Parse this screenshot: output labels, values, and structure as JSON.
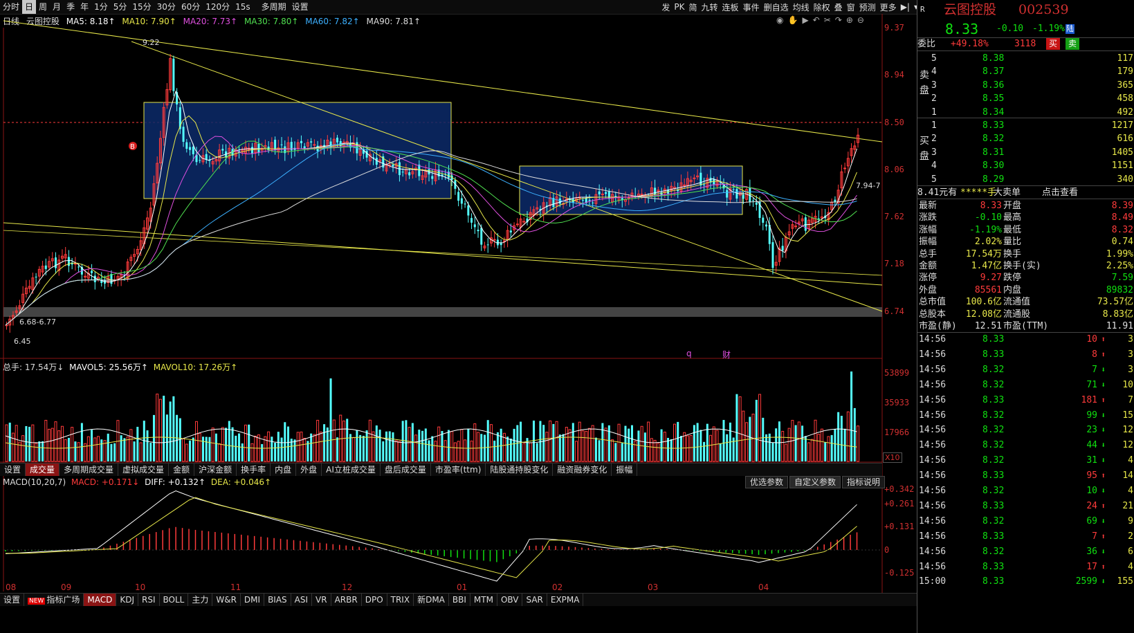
{
  "toolbar": {
    "periods": [
      "分时",
      "日",
      "周",
      "月",
      "季",
      "年",
      "1分",
      "5分",
      "15分",
      "30分",
      "60分",
      "120分",
      "15s",
      "多周期",
      "设置"
    ],
    "active_period": "日",
    "right_items": [
      "发",
      "PK",
      "简",
      "九转",
      "连板",
      "事件",
      "删自选",
      "均线",
      "除权",
      "叠",
      "窗",
      "预测",
      "更多"
    ]
  },
  "ma_line": {
    "period": "日线",
    "stock": "云图控股",
    "ma5": "MA5: 8.18↑",
    "ma10": "MA10: 7.90↑",
    "ma20": "MA20: 7.73↑",
    "ma30": "MA30: 7.80↑",
    "ma60": "MA60: 7.82↑",
    "ma90": "MA90: 7.81↑"
  },
  "price_axis": [
    "9.37",
    "8.94",
    "8.50",
    "8.06",
    "7.62",
    "7.18",
    "6.74"
  ],
  "price_annotations": {
    "high": "9.22",
    "low": "6.45",
    "range_low": "6.68-6.77",
    "range_right": "7.94-7",
    "buy_marker": "B"
  },
  "event_markers": [
    "q",
    "财"
  ],
  "volume": {
    "title": "总手: 17.54万↓",
    "mavol5": "MAVOL5: 25.56万↑",
    "mavol10": "MAVOL10: 17.26万↑",
    "axis": [
      "53899",
      "35933",
      "17966"
    ],
    "unit": "X10"
  },
  "sub_tabs": [
    "设置",
    "成交量",
    "多周期成交量",
    "虚拟成交量",
    "金额",
    "沪深金额",
    "换手率",
    "内盘",
    "外盘",
    "AI立桩成交量",
    "盘后成交量",
    "市盈率(ttm)",
    "陆股通持股变化",
    "融资融券变化",
    "振幅"
  ],
  "active_sub_tab": "成交量",
  "macd": {
    "title": "MACD(10,20,7)",
    "macd": "MACD: +0.171↓",
    "diff": "DIFF: +0.132↑",
    "dea": "DEA: +0.046↑",
    "axis": [
      "+0.342",
      "+0.261",
      "+0.131",
      "0",
      "-0.125"
    ],
    "buttons": [
      "优选参数",
      "自定义参数",
      "指标说明"
    ]
  },
  "x_axis": [
    "08",
    "09",
    "10",
    "11",
    "12",
    "01",
    "02",
    "03",
    "04"
  ],
  "bottom_bar": [
    "设置",
    "指标广场",
    "MACD",
    "KDJ",
    "RSI",
    "BOLL",
    "主力",
    "W&R",
    "DMI",
    "BIAS",
    "ASI",
    "VR",
    "ARBR",
    "DPO",
    "TRIX",
    "新DMA",
    "BBI",
    "MTM",
    "OBV",
    "SAR",
    "EXPMA"
  ],
  "bottom_new_tag": "NEW",
  "active_indicator": "MACD",
  "quote": {
    "tag": "R",
    "name": "云图控股",
    "code": "002539",
    "price": "8.33",
    "change": "-0.10",
    "change_pct": "-1.19%",
    "market": "陆",
    "weibi_label": "委比",
    "weibi": "+49.18%",
    "weicha": "3118",
    "buy_btn": "买",
    "sell_btn": "卖",
    "sell_label": "卖盘",
    "buy_label": "买盘",
    "sells": [
      {
        "lvl": "5",
        "price": "8.38",
        "vol": "117"
      },
      {
        "lvl": "4",
        "price": "8.37",
        "vol": "179"
      },
      {
        "lvl": "3",
        "price": "8.36",
        "vol": "365"
      },
      {
        "lvl": "2",
        "price": "8.35",
        "vol": "458"
      },
      {
        "lvl": "1",
        "price": "8.34",
        "vol": "492"
      }
    ],
    "buys": [
      {
        "lvl": "1",
        "price": "8.33",
        "vol": "1217"
      },
      {
        "lvl": "2",
        "price": "8.32",
        "vol": "616"
      },
      {
        "lvl": "3",
        "price": "8.31",
        "vol": "1405"
      },
      {
        "lvl": "4",
        "price": "8.30",
        "vol": "1151"
      },
      {
        "lvl": "5",
        "price": "8.29",
        "vol": "340"
      }
    ],
    "big_order": {
      "price": "8.41元有",
      "hands": "*****手",
      "label": "大卖单",
      "link": "点击查看"
    },
    "stats": [
      {
        "k1": "最新",
        "v1": "8.33",
        "k2": "开盘",
        "v2": "8.39",
        "c1": "red",
        "c2": "red"
      },
      {
        "k1": "涨跌",
        "v1": "-0.10",
        "k2": "最高",
        "v2": "8.49",
        "c1": "green",
        "c2": "red"
      },
      {
        "k1": "涨幅",
        "v1": "-1.19%",
        "k2": "最低",
        "v2": "8.32",
        "c1": "green",
        "c2": "red"
      },
      {
        "k1": "振幅",
        "v1": "2.02%",
        "k2": "量比",
        "v2": "0.74",
        "c1": "yellow",
        "c2": "yellow"
      },
      {
        "k1": "总手",
        "v1": "17.54万",
        "k2": "换手",
        "v2": "1.99%",
        "c1": "yellow",
        "c2": "yellow"
      },
      {
        "k1": "金额",
        "v1": "1.47亿",
        "k2": "换手(实)",
        "v2": "2.25%",
        "c1": "yellow",
        "c2": "yellow"
      },
      {
        "k1": "涨停",
        "v1": "9.27",
        "k2": "跌停",
        "v2": "7.59",
        "c1": "red",
        "c2": "green"
      },
      {
        "k1": "外盘",
        "v1": "85561",
        "k2": "内盘",
        "v2": "89832",
        "c1": "red",
        "c2": "green"
      },
      {
        "k1": "总市值",
        "v1": "100.6亿",
        "k2": "流通值",
        "v2": "73.57亿",
        "c1": "yellow",
        "c2": "yellow"
      },
      {
        "k1": "总股本",
        "v1": "12.08亿",
        "k2": "流通股",
        "v2": "8.83亿",
        "c1": "yellow",
        "c2": "yellow"
      },
      {
        "k1": "市盈(静)",
        "v1": "12.51",
        "k2": "市盈(TTM)",
        "v2": "11.91",
        "c1": "white",
        "c2": "white"
      }
    ],
    "ticks": [
      {
        "time": "14:56",
        "price": "8.33",
        "vol": "10",
        "dir": "up",
        "n": "3"
      },
      {
        "time": "14:56",
        "price": "8.33",
        "vol": "8",
        "dir": "up",
        "n": "3"
      },
      {
        "time": "14:56",
        "price": "8.32",
        "vol": "7",
        "dir": "down",
        "n": "3"
      },
      {
        "time": "14:56",
        "price": "8.32",
        "vol": "71",
        "dir": "down",
        "n": "10"
      },
      {
        "time": "14:56",
        "price": "8.33",
        "vol": "181",
        "dir": "up",
        "n": "7"
      },
      {
        "time": "14:56",
        "price": "8.32",
        "vol": "99",
        "dir": "down",
        "n": "15"
      },
      {
        "time": "14:56",
        "price": "8.32",
        "vol": "23",
        "dir": "down",
        "n": "12"
      },
      {
        "time": "14:56",
        "price": "8.32",
        "vol": "44",
        "dir": "down",
        "n": "12"
      },
      {
        "time": "14:56",
        "price": "8.32",
        "vol": "31",
        "dir": "down",
        "n": "4"
      },
      {
        "time": "14:56",
        "price": "8.33",
        "vol": "95",
        "dir": "up",
        "n": "14"
      },
      {
        "time": "14:56",
        "price": "8.32",
        "vol": "10",
        "dir": "down",
        "n": "4"
      },
      {
        "time": "14:56",
        "price": "8.33",
        "vol": "24",
        "dir": "up",
        "n": "21"
      },
      {
        "time": "14:56",
        "price": "8.32",
        "vol": "69",
        "dir": "down",
        "n": "9"
      },
      {
        "time": "14:56",
        "price": "8.33",
        "vol": "7",
        "dir": "up",
        "n": "2"
      },
      {
        "time": "14:56",
        "price": "8.32",
        "vol": "36",
        "dir": "down",
        "n": "6"
      },
      {
        "time": "14:56",
        "price": "8.33",
        "vol": "17",
        "dir": "up",
        "n": "4"
      },
      {
        "time": "15:00",
        "price": "8.33",
        "vol": "2599",
        "dir": "down",
        "n": "155"
      }
    ]
  },
  "colors": {
    "up": "#ff3b3b",
    "down": "#10e010",
    "candle_down": "#54ffff",
    "box_fill": "#0c2a6a",
    "box_border": "#e8e84a"
  }
}
